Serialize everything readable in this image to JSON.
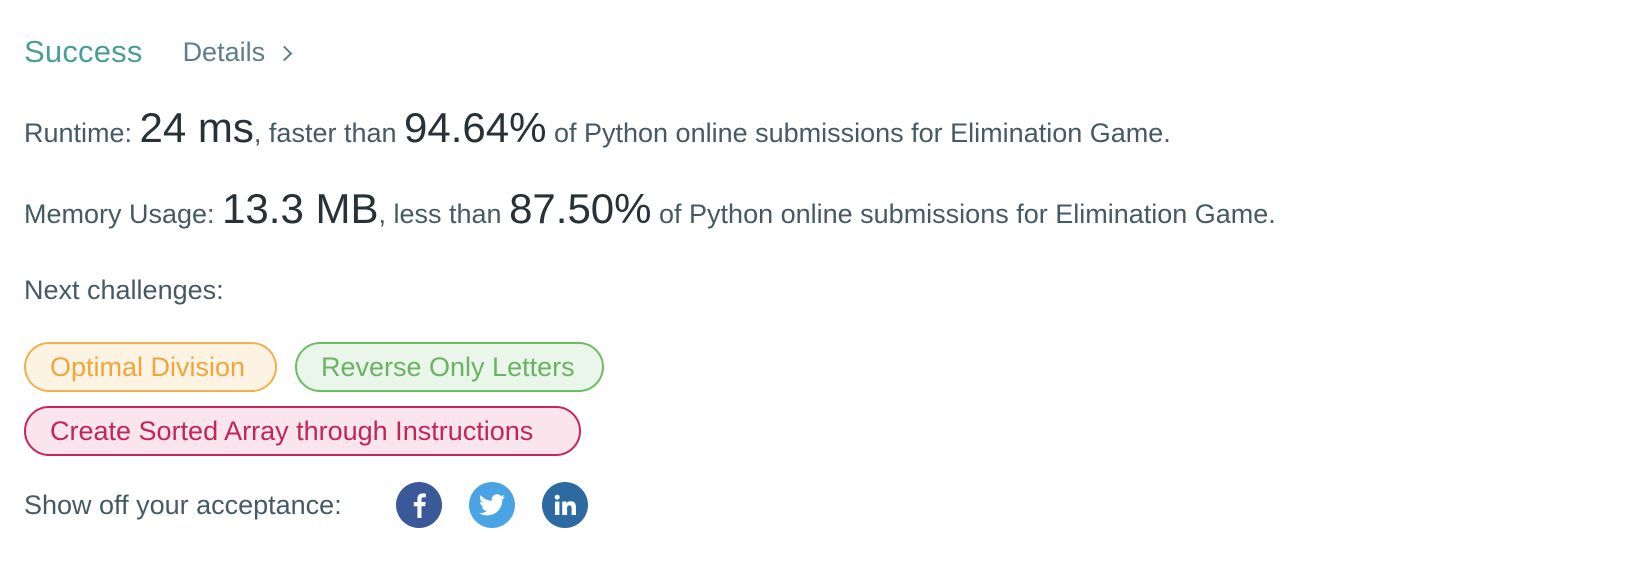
{
  "result": {
    "status": "Success",
    "details_label": "Details"
  },
  "runtime": {
    "label": "Runtime: ",
    "value": "24 ms",
    "comparison": ", faster than ",
    "percent": "94.64%",
    "suffix": " of Python online submissions for Elimination Game."
  },
  "memory": {
    "label": "Memory Usage: ",
    "value": "13.3 MB",
    "comparison": ", less than ",
    "percent": "87.50%",
    "suffix": " of Python online submissions for Elimination Game."
  },
  "next_challenges": {
    "label": "Next challenges:",
    "items": [
      {
        "title": "Optimal Division",
        "color": "#eea63f"
      },
      {
        "title": "Reverse Only Letters",
        "color": "#6cb264"
      },
      {
        "title": "Create Sorted Array through Instructions",
        "color": "#c22559"
      }
    ]
  },
  "share": {
    "label": "Show off your acceptance:",
    "icons": [
      "facebook-icon",
      "twitter-icon",
      "linkedin-icon"
    ]
  },
  "colors": {
    "success": "#4a9f94",
    "facebook": "#3b5998",
    "twitter": "#4aa3e3",
    "linkedin": "#2d6aa1"
  }
}
